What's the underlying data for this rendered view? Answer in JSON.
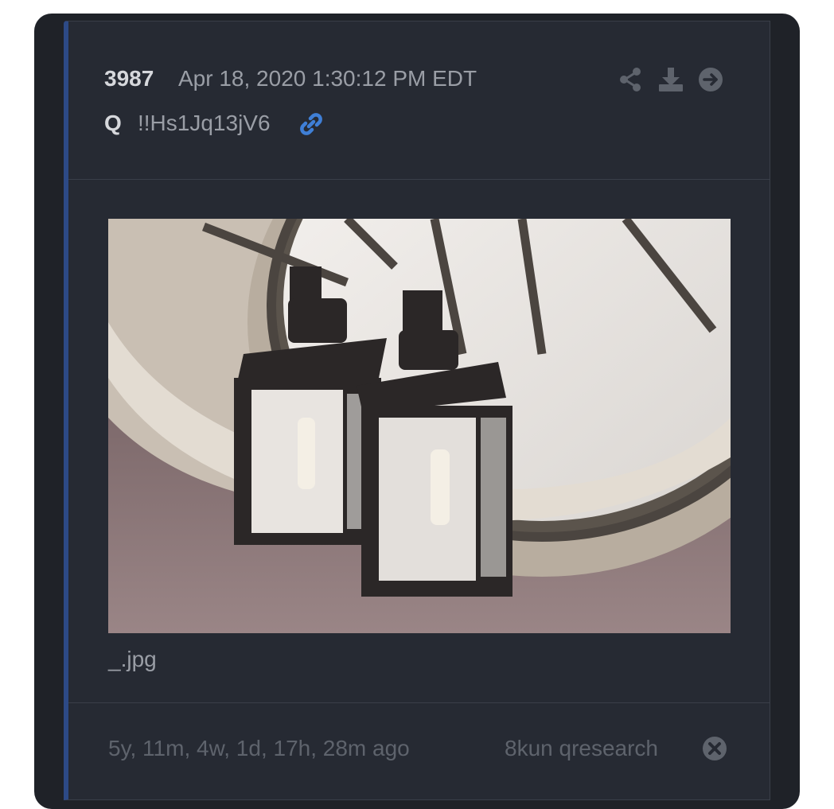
{
  "post": {
    "number": "3987",
    "timestamp": "Apr 18, 2020 1:30:12 PM EDT",
    "author": "Q",
    "tripcode": "!!Hs1Jq13jV6",
    "filename": "_.jpg"
  },
  "footer": {
    "age": "5y, 11m, 4w, 1d, 17h, 28m ago",
    "board": "8kun qresearch"
  },
  "icons": {
    "link": "link-icon",
    "share": "share-icon",
    "download": "download-icon",
    "open": "arrow-right-circle-icon",
    "close": "close-circle-icon"
  },
  "colors": {
    "card_bg": "#262a33",
    "outer_bg": "#1f2228",
    "accent_border": "#2d4a86",
    "link_blue": "#3f7fd6",
    "muted_text": "#9a9ea6",
    "faint_text": "#5e636c"
  }
}
